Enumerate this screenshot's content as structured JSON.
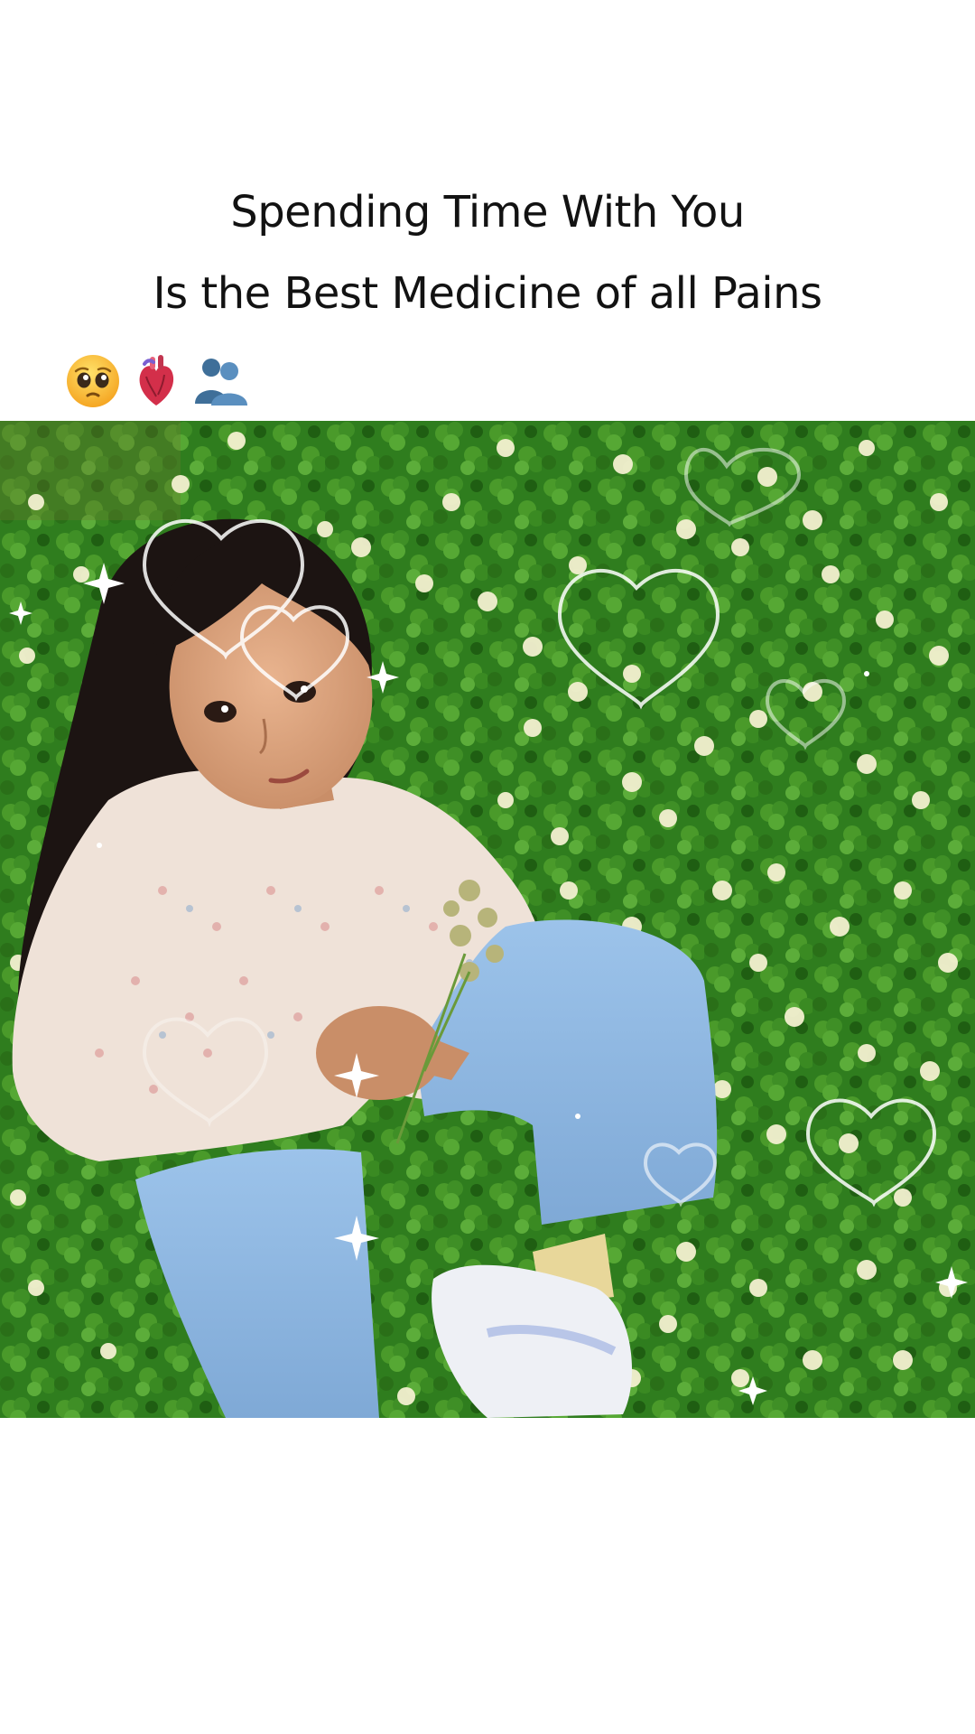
{
  "caption": {
    "line1": "Spending Time With You",
    "line2": "Is the Best Medicine of all Pains"
  },
  "emojis": [
    "pleading-face-icon",
    "anatomical-heart-icon",
    "busts-in-silhouette-icon"
  ],
  "colors": {
    "background": "#ffffff",
    "text": "#121212",
    "grass": "#2f7d1e",
    "jeans": "#8fb8e3",
    "jacket": "#efe2d8"
  }
}
